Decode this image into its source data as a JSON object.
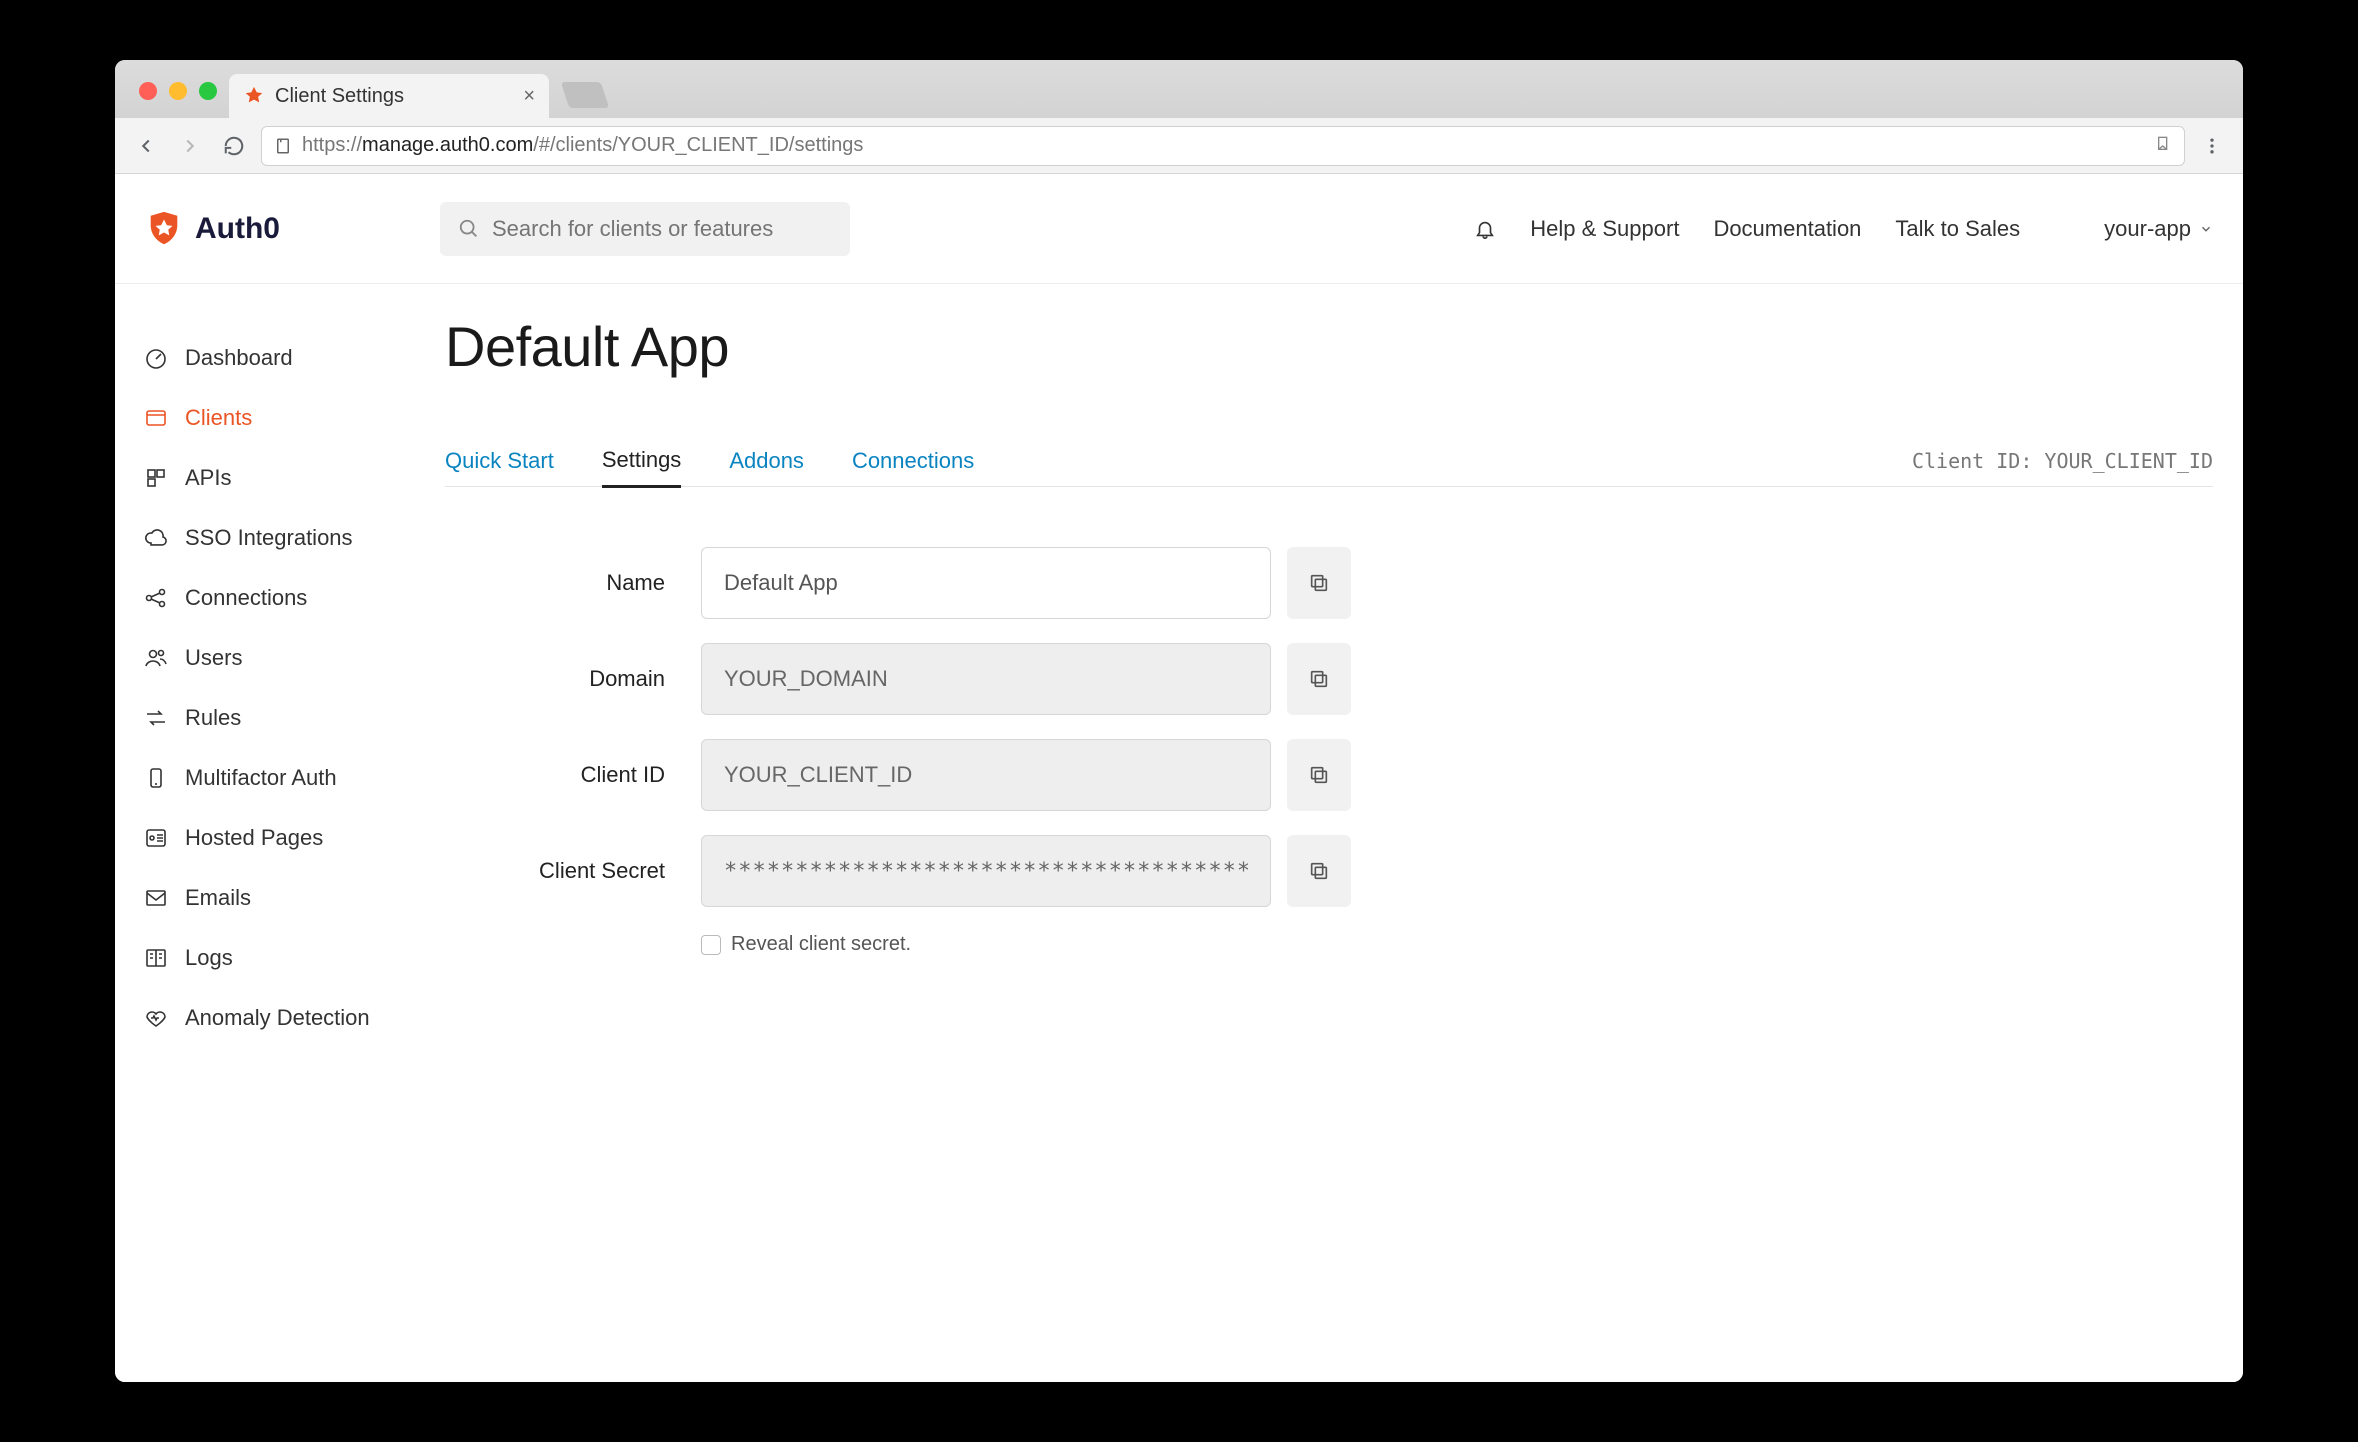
{
  "browser": {
    "tab_title": "Client Settings",
    "url_prefix": "https://",
    "url_host": "manage.auth0.com",
    "url_path": "/#/clients/YOUR_CLIENT_ID/settings"
  },
  "header": {
    "brand": "Auth0",
    "search_placeholder": "Search for clients or features",
    "links": {
      "help": "Help & Support",
      "docs": "Documentation",
      "sales": "Talk to Sales"
    },
    "tenant": "your-app"
  },
  "sidebar": {
    "items": [
      {
        "label": "Dashboard",
        "icon": "gauge"
      },
      {
        "label": "Clients",
        "icon": "window",
        "active": true
      },
      {
        "label": "APIs",
        "icon": "cube"
      },
      {
        "label": "SSO Integrations",
        "icon": "cloud"
      },
      {
        "label": "Connections",
        "icon": "share"
      },
      {
        "label": "Users",
        "icon": "users"
      },
      {
        "label": "Rules",
        "icon": "arrows"
      },
      {
        "label": "Multifactor Auth",
        "icon": "phone"
      },
      {
        "label": "Hosted Pages",
        "icon": "layout"
      },
      {
        "label": "Emails",
        "icon": "mail"
      },
      {
        "label": "Logs",
        "icon": "book"
      },
      {
        "label": "Anomaly Detection",
        "icon": "heart"
      }
    ]
  },
  "page": {
    "title": "Default App",
    "tabs": [
      {
        "label": "Quick Start"
      },
      {
        "label": "Settings",
        "active": true
      },
      {
        "label": "Addons"
      },
      {
        "label": "Connections"
      }
    ],
    "client_id_label": "Client ID: YOUR_CLIENT_ID",
    "form": {
      "name": {
        "label": "Name",
        "value": "Default App"
      },
      "domain": {
        "label": "Domain",
        "value": "YOUR_DOMAIN"
      },
      "client_id": {
        "label": "Client ID",
        "value": "YOUR_CLIENT_ID"
      },
      "client_secret": {
        "label": "Client Secret",
        "value": "**********************************************"
      },
      "reveal_label": "Reveal client secret."
    }
  },
  "colors": {
    "accent": "#eb5424",
    "link": "#0a84c1"
  }
}
